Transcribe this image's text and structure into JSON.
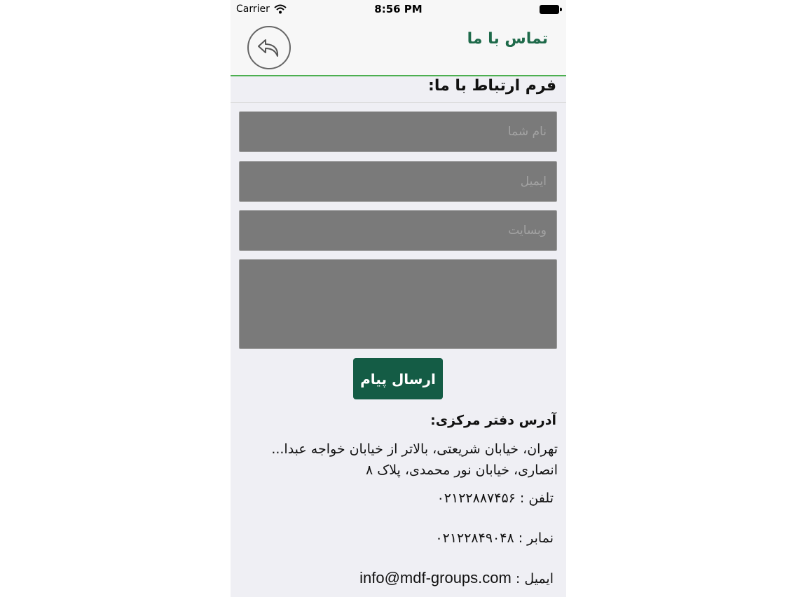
{
  "status_bar": {
    "carrier": "Carrier",
    "time": "8:56 PM"
  },
  "nav": {
    "title": "تماس با ما",
    "back_icon": "back-arrow-icon"
  },
  "form": {
    "heading": "فرم ارتباط با ما:",
    "name_placeholder": "نام شما",
    "email_placeholder": "ایمیل",
    "website_placeholder": "وبسایت",
    "message_placeholder": "",
    "send_label": "ارسال پیام"
  },
  "contact": {
    "address_heading": "آدرس دفتر مرکزی:",
    "address": "تهران، خیابان شریعتی، بالاتر از خیابان خواجه عبدا... انصاری، خیابان نور محمدی، پلاک ۸",
    "phone_label": "تلفن : ",
    "phone": "۰۲۱۲۲۸۸۷۴۵۶",
    "fax_label": "نمابر : ",
    "fax": "۰۲۱۲۲۸۴۹۰۴۸",
    "email_label": "ایمیل : ",
    "email": "info@mdf-groups.com"
  },
  "colors": {
    "accent": "#145c45",
    "title": "#1e6a4a",
    "divider": "#4caf50",
    "field_bg": "#7a7a7a"
  }
}
